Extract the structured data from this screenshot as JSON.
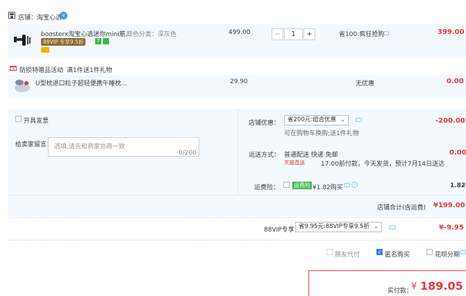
{
  "shop": {
    "label": "店铺：淘宝心选",
    "verified_icon": "v"
  },
  "item1": {
    "title": "boosterx淘宝心选迷你mini筋...",
    "attr": "颜色分类：深灰色",
    "vip_badge": "88VIP 专享9.5折",
    "price": "499.00",
    "qty": "1",
    "promo": "省100:疯狂抢购",
    "total": "399.00"
  },
  "gift": {
    "activity": "防损特赠品活动",
    "rule": "满1件送1件礼物"
  },
  "item2": {
    "title": "U型枕退口粒子超轻便携午睡枕...",
    "price": "29.90",
    "promo": "无优惠",
    "total": "0.00"
  },
  "invoice": {
    "label": "开具发票"
  },
  "message": {
    "label": "给卖家留言：",
    "placeholder": "选填,请先和商家协商一致",
    "counter": "0/200"
  },
  "shop_discount": {
    "label": "店铺优惠：",
    "selected": "省200元:组合优惠",
    "note": "可在购物车换购;送1件礼物",
    "amount": "-200.00"
  },
  "shipping": {
    "label": "运送方式：",
    "method": "普通配送 快递 免邮",
    "tag": "天猫直送",
    "eta": "17:00前付款，今天发货，预计7月14日送达",
    "amount": "0.00"
  },
  "insurance": {
    "label": "运费险：",
    "badge": "运费险",
    "text": "¥1.82购买",
    "amount": "1.82"
  },
  "shop_total": {
    "label": "店铺合计(含运费)",
    "amount": "¥199.00"
  },
  "vip": {
    "label": "88VIP专享",
    "selected": "省9.95元:88VIP专享9.5折",
    "amount": "¥-9.95"
  },
  "pay_options": {
    "friend": "朋友代付",
    "anonymous": "匿名购买",
    "huabei": "花呗分期"
  },
  "payment": {
    "label": "实付款：",
    "currency": "¥",
    "amount": "189.05"
  },
  "colors": {
    "accent_red": "#e4393c",
    "accent_blue": "#3d7ff0",
    "row_bg": "#f3f9ff"
  }
}
